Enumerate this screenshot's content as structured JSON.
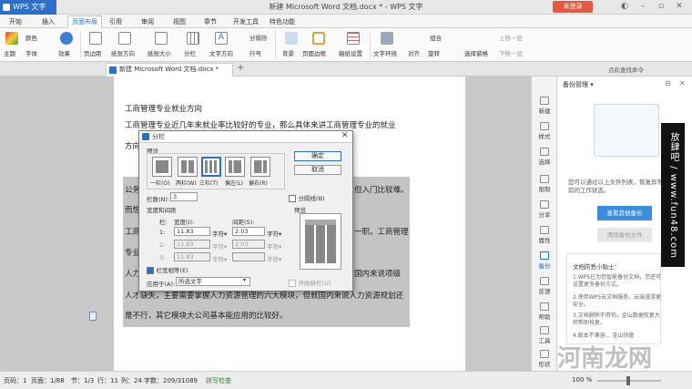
{
  "app": {
    "name": "WPS 文字",
    "title": "新建 Microsoft Word 文档.docx * - WPS 文字",
    "login": "未登录"
  },
  "menu": [
    "开始",
    "插入",
    "页面布局",
    "引用",
    "审阅",
    "视图",
    "章节",
    "开发工具",
    "特色功能"
  ],
  "ribbon": {
    "theme": "主题",
    "color": "颜色",
    "font": "字体",
    "effect": "效果",
    "margins": "页边距",
    "orientation": "纸张方向",
    "size": "纸张大小",
    "columns": "分栏",
    "text_dir": "文字方向",
    "line_num": "行号",
    "break": "分隔符",
    "background": "背景",
    "border": "页面边框",
    "grid_setup": "稿纸设置",
    "wrap": "文字环绕",
    "align": "对齐",
    "rotate": "旋转",
    "select_pane": "选择窗格",
    "group": "组合",
    "up": "上移一层",
    "down": "下移一层"
  },
  "tab": {
    "doc": "新建 Microsoft Word 文档.docx *",
    "add": "+",
    "user": "点此查找命令"
  },
  "document": {
    "lines": [
      "工商管理专业就业方向",
      "工商管理专业近几年来就业率比较好的专业，那么具体来讲工商管理专业的就业",
      "方向",
      "公务",
      "而想",
      "工商",
      "专业",
      "人力",
      "人才缺失，主要需要掌握人力资源管理的六大模块，但就国内来说人力资源规划还",
      "是不行，其它模块大公司基本能应用的比较好。"
    ],
    "right_fragments": [
      "但入门比较难。",
      "一职。工商管理",
      "国内来说项级"
    ]
  },
  "dialog": {
    "title": "分栏",
    "preset_label": "预设",
    "presets": [
      "一栏(O)",
      "两栏(W)",
      "三栏(T)",
      "偏左(L)",
      "偏右(R)"
    ],
    "ok": "确定",
    "cancel": "取消",
    "columns_label": "栏数(N):",
    "columns_value": "3",
    "divider": "分隔线(B)",
    "width_spacing": "宽度和间距",
    "preview": "预览",
    "col_header": "栏:",
    "width_header": "宽度(I):",
    "spacing_header": "间距(S):",
    "rows": [
      {
        "n": "1:",
        "w": "11.83",
        "wu": "字符▾",
        "s": "2.03",
        "su": "字符▾"
      },
      {
        "n": "2:",
        "w": "11.83",
        "wu": "字符▾",
        "s": "2.03",
        "su": "字符▾"
      },
      {
        "n": "3:",
        "w": "11.83",
        "wu": "字符▾",
        "s": "",
        "su": "字符▾"
      }
    ],
    "equal": "栏宽相等(E)",
    "apply_label": "应用于(A):",
    "apply_value": "所选文字",
    "new_col": "开始新栏(U)"
  },
  "sidebar": [
    "新建",
    "样式",
    "选择",
    "限制",
    "分享",
    "属性",
    "备份",
    "反馈",
    "帮助",
    "工具",
    "形状"
  ],
  "panel": {
    "title": "备份管理 ▾",
    "desc": "您可以通过以上文件列表，恢复异常之前的工作状态。",
    "btn_view": "查看其他备份",
    "btn_clear": "清除备份文件",
    "tips_title": "文档防丢小贴士：",
    "tips": [
      "1.WPS已为您智能备份文档，您还可设置更多备份方式。",
      "2.使用WPS云文档服务，云端漫游更安全。",
      "3.文档删除不用怕，金山数据恢复大师帮助恢复。",
      "4.版本不兼容... 金山快盘"
    ]
  },
  "status": {
    "page": "页码：1",
    "pages": "页面：1/88",
    "section": "节：1/3",
    "row": "行：11",
    "col": "列：24",
    "words": "字数：209/31089",
    "spell": "拼写检查",
    "zoom": "100 %"
  },
  "watermark": {
    "vertical": "放肆吧 / www.fun48.com",
    "corner": "河南龙网"
  }
}
